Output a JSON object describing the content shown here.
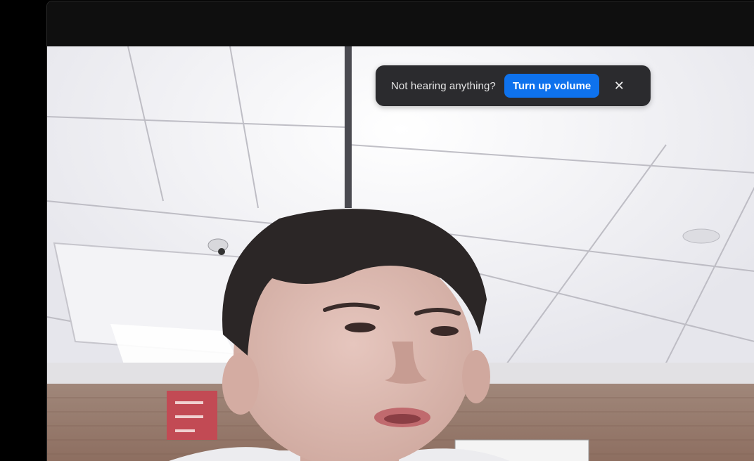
{
  "notification": {
    "message": "Not hearing anything?",
    "action_label": "Turn up volume",
    "close_icon": "close-icon",
    "action_color": "#0e72ed",
    "background_color": "#2b2b2e"
  },
  "video": {
    "content": "participant-camera-feed"
  }
}
